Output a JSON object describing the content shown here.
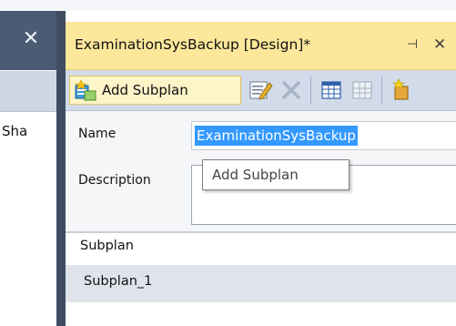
{
  "left_pane": {
    "close_glyph": "✕",
    "visible_text": "Sha"
  },
  "document_tab": {
    "title": "ExaminationSysBackup [Design]*",
    "pin_glyph": "⊣",
    "close_glyph": "✕"
  },
  "toolbar": {
    "add_subplan_label": "Add Subplan",
    "icons": [
      "add-subplan-icon",
      "edit-properties-icon",
      "delete-icon",
      "schedule-grid-icon",
      "remove-schedule-icon",
      "manage-connections-icon"
    ]
  },
  "form": {
    "name_label": "Name",
    "name_value": "ExaminationSysBackup",
    "description_label": "Description",
    "description_value": ""
  },
  "tooltip": {
    "text": "Add Subplan"
  },
  "subplan_grid": {
    "header": "Subplan",
    "rows": [
      "Subplan_1"
    ]
  },
  "colors": {
    "tab_active": "#fce79b",
    "toolbar": "#d1dbe9",
    "selection": "#3399ff",
    "dark_chrome": "#3f4d63"
  }
}
